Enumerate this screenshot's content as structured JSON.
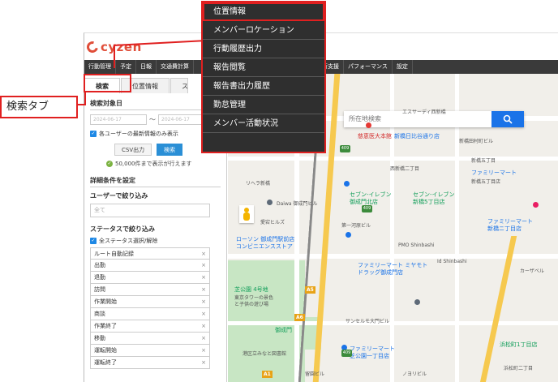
{
  "app": {
    "logo_text": "cyzen",
    "brand_color": "#e04e39",
    "accent_color": "#1a73e8"
  },
  "navbar": {
    "items": [
      "行動管理",
      "予定",
      "日報",
      "交通費計算"
    ],
    "right_items": [
      "行支援",
      "パフォーマンス",
      "設定"
    ]
  },
  "tabs": {
    "search": "検索",
    "location": "位置情報",
    "third": "スポ"
  },
  "panel": {
    "date_title": "検索対象日",
    "date_from": "2024-06-17",
    "date_to": "2024-06-17",
    "tilde": "〜",
    "latest_checkbox": "各ユーザーの最新情報のみ表示",
    "csv_button": "CSV出力",
    "search_button": "検索",
    "note_icon": "check-circle-icon",
    "note": "50,000件まで表示が行えます",
    "detail_title": "詳細条件を設定",
    "user_filter_title": "ユーザーで絞り込み",
    "user_filter_value": "全て",
    "status_filter_title": "ステータスで絞り込み",
    "status_all_checkbox": "全ステータス選択/解除",
    "statuses": [
      "ルート自動記録",
      "出勤",
      "退勤",
      "訪問",
      "作業開始",
      "商談",
      "作業終了",
      "移動",
      "運転開始",
      "運転終了"
    ],
    "remove_symbol": "×"
  },
  "map": {
    "search_placeholder": "所在地検索",
    "labels": {
      "l1": "エスサーディ西新橋",
      "l2": "新橋田村町ビル",
      "l3": "西新橋二丁目",
      "l4": "新橋五丁目",
      "l5": "芝公園 4号地",
      "l6": "東京タワーの景色",
      "l7": "と子供の遊び場",
      "l8": "港区立みなと図書館",
      "l9": "御成門",
      "l10": "浜松町二丁目",
      "l11": "リヘラ新橋",
      "l12": "第一河原ビル",
      "l13": "ローソン 御成門駅前店",
      "l14": "コンビニエンスストア",
      "l15": "ファミリーマート ミヤモト",
      "l16": "ドラッグ御成門店",
      "l17": "セブン-イレブン",
      "l18": "御成門北店",
      "l19": "新橋5丁目店",
      "l20": "ファミリーマート",
      "l21": "芝公園一丁目店",
      "l22": "サンセルモ大門ビル",
      "l23": "プレスビル",
      "l24": "御成門北店",
      "l25": "新橋丁目店",
      "l26": "セブン-イレブン",
      "l27": "浜松町1丁目店",
      "l28": "ファミリーマート",
      "l29": "新橋五丁目店",
      "l30": "Daiwa 御成門ビル",
      "l31": "PMO Shinbashi",
      "l32": "Id Shinbashi",
      "l33": "愛宕ヒルズ",
      "l34": "留園ビル",
      "l35": "カーザベル",
      "l36": "ファミリーマート",
      "l37": "新橋ニ丁目店",
      "l38": "新橋日比谷通り店",
      "l39": "慈恵医大本館",
      "l40": "ノヨリビル",
      "l41": "パレスビル"
    },
    "routes": {
      "r409": "409",
      "a5": "A5",
      "a6": "A6",
      "a1": "A1"
    },
    "park_color": "#c8e6c4",
    "road_color": "#f6c94f"
  },
  "menu": {
    "items": [
      "位置情報",
      "メンバーロケーション",
      "行動履歴出力",
      "報告閲覧",
      "報告書出力履歴",
      "勤怠管理",
      "メンバー活動状況"
    ],
    "highlight_color": "#e02020"
  },
  "annotation": {
    "callout": "検索タブ"
  }
}
